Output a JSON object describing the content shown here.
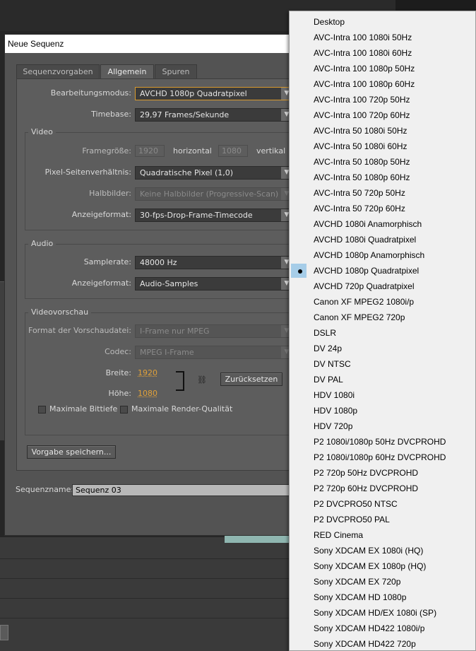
{
  "dialog": {
    "title": "Neue Sequenz",
    "tabs": [
      "Sequenzvorgaben",
      "Allgemein",
      "Spuren"
    ],
    "active_tab": "Allgemein",
    "editing_mode_label": "Bearbeitungsmodus:",
    "editing_mode_value": "AVCHD 1080p Quadratpixel",
    "timebase_label": "Timebase:",
    "timebase_value": "29,97 Frames/Sekunde",
    "video": {
      "title": "Video",
      "frame_size_label": "Framegröße:",
      "frame_width": "1920",
      "horizontal_label": "horizontal",
      "frame_height": "1080",
      "vertical_label": "vertikal",
      "pixel_aspect_label": "Pixel-Seitenverhältnis:",
      "pixel_aspect_value": "Quadratische Pixel (1,0)",
      "fields_label": "Halbbilder:",
      "fields_value": "Keine Halbbilder (Progressive-Scan)",
      "display_format_label": "Anzeigeformat:",
      "display_format_value": "30-fps-Drop-Frame-Timecode"
    },
    "audio": {
      "title": "Audio",
      "samplerate_label": "Samplerate:",
      "samplerate_value": "48000 Hz",
      "display_format_label": "Anzeigeformat:",
      "display_format_value": "Audio-Samples"
    },
    "preview": {
      "title": "Videovorschau",
      "format_label": "Format der Vorschaudatei:",
      "format_value": "I-Frame nur MPEG",
      "codec_label": "Codec:",
      "codec_value": "MPEG I-Frame",
      "width_label": "Breite:",
      "width_value": "1920",
      "height_label": "Höhe:",
      "height_value": "1080",
      "reset_button": "Zurücksetzen",
      "max_bit_depth": "Maximale Bittiefe",
      "max_render_quality": "Maximale Render-Qualität"
    },
    "save_preset_button": "Vorgabe speichern...",
    "sequence_name_label": "Sequenzname:",
    "sequence_name_value": "Sequenz 03"
  },
  "menu": {
    "selected": "AVCHD 1080p Quadratpixel",
    "items": [
      "Desktop",
      "AVC-Intra 100 1080i 50Hz",
      "AVC-Intra 100 1080i 60Hz",
      "AVC-Intra 100 1080p 50Hz",
      "AVC-Intra 100 1080p 60Hz",
      "AVC-Intra 100 720p 50Hz",
      "AVC-Intra 100 720p 60Hz",
      "AVC-Intra 50 1080i 50Hz",
      "AVC-Intra 50 1080i 60Hz",
      "AVC-Intra 50 1080p 50Hz",
      "AVC-Intra 50 1080p 60Hz",
      "AVC-Intra 50 720p 50Hz",
      "AVC-Intra 50 720p 60Hz",
      "AVCHD 1080i Anamorphisch",
      "AVCHD 1080i Quadratpixel",
      "AVCHD 1080p Anamorphisch",
      "AVCHD 1080p Quadratpixel",
      "AVCHD 720p Quadratpixel",
      "Canon XF MPEG2 1080i/p",
      "Canon XF MPEG2 720p",
      "DSLR",
      "DV 24p",
      "DV NTSC",
      "DV PAL",
      "HDV 1080i",
      "HDV 1080p",
      "HDV 720p",
      "P2 1080i/1080p 50Hz DVCPROHD",
      "P2 1080i/1080p 60Hz DVCPROHD",
      "P2 720p 50Hz DVCPROHD",
      "P2 720p 60Hz DVCPROHD",
      "P2 DVCPRO50 NTSC",
      "P2 DVCPRO50 PAL",
      "RED Cinema",
      "Sony XDCAM EX 1080i (HQ)",
      "Sony XDCAM EX 1080p (HQ)",
      "Sony XDCAM EX 720p",
      "Sony XDCAM HD 1080p",
      "Sony XDCAM HD/EX 1080i (SP)",
      "Sony XDCAM HD422 1080i/p",
      "Sony XDCAM HD422 720p"
    ]
  },
  "colors": {
    "accent_orange": "#e0a13a",
    "selection_blue": "#a6cde8"
  }
}
